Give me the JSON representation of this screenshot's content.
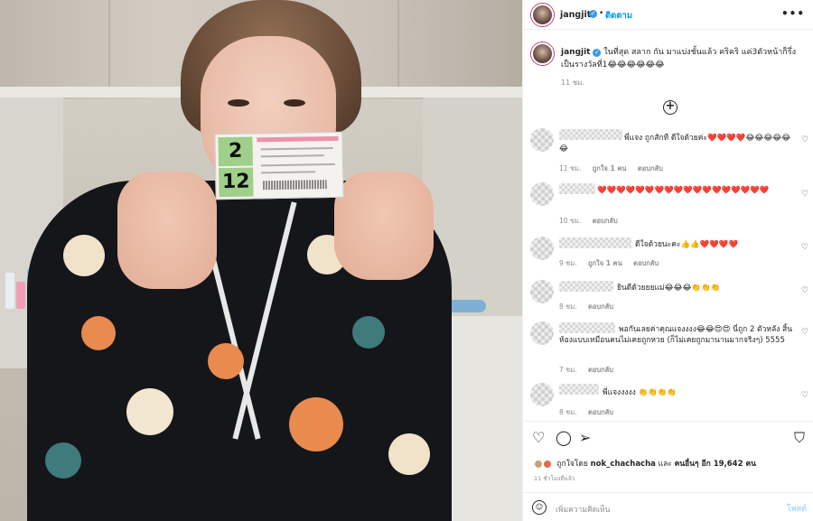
{
  "post": {
    "username": "jangjit",
    "verified_mark": "✓",
    "follow_label": "ติดตาม",
    "more_label": "•••",
    "caption": "ในที่สุด สลาก กัน มาแบ่งชั้นแล้ว คริคริ แค่3ตัวหน้าก็รึ่งเป็นรางวัลที่1😂😂😂😂😂😂",
    "caption_time": "11 ชม.",
    "load_more_label": "+",
    "ticket_top_digit": "2",
    "ticket_bottom_digit": "12"
  },
  "comments": [
    {
      "text": "พี่แจง ถูกสักที ดีใจด้วยค่ะ❤️❤️❤️❤️😂😂😂😂😂😂",
      "time": "11 ชม.",
      "likes": "ถูกใจ 1 คน",
      "reply": "ตอบกลับ"
    },
    {
      "text": "❤️❤️❤️❤️❤️❤️❤️❤️❤️❤️❤️❤️❤️❤️❤️❤️❤️❤️",
      "time": "10 ชม.",
      "likes": "",
      "reply": "ตอบกลับ"
    },
    {
      "text": "ดีใจด้วยนะคะ👍👍❤️❤️❤️❤️",
      "time": "9 ชม.",
      "likes": "ถูกใจ 1 คน",
      "reply": "ตอบกลับ"
    },
    {
      "text": "ยินดีด้วยยยแม่😂😂😂👏👏👏",
      "time": "8 ชม.",
      "likes": "",
      "reply": "ตอบกลับ"
    },
    {
      "text": "พอกันเลยค่าคุณแจงงงง😂😂😍😍 นี่ถูก 2 ตัวหลัง สิ้นห้องแบบเหมือนคนไม่เคยถูกหวย (ก็ไม่เคยถูกมานานมากจริงๆ) 5555",
      "time": "7 ชม.",
      "likes": "",
      "reply": "ตอบกลับ"
    },
    {
      "text": "พี่แจงงงงง 👏👏👏👏",
      "time": "8 ชม.",
      "likes": "",
      "reply": "ตอบกลับ"
    }
  ],
  "actions": {
    "liked_by_prefix": "ถูกใจโดย",
    "liked_by_user": "nok_chachacha",
    "liked_by_mid": "และ",
    "liked_by_others": "คนอื่นๆ อีก 19,642 คน",
    "posted_time": "11 ชั่วโมงที่แล้ว",
    "comment_placeholder": "เพิ่มความคิดเห็น",
    "post_label": "โพสต์"
  },
  "icons": {
    "heart": "♡",
    "comment": "◯",
    "share": "➢",
    "save": "⛉",
    "emoji": "☺",
    "more": "•••"
  },
  "colors": {
    "accent": "#0095f6",
    "verified": "#3897f0",
    "muted": "#8e8e8e"
  }
}
